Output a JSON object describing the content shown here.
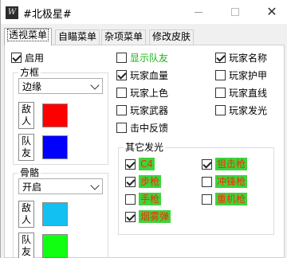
{
  "window": {
    "title": "#北极星#",
    "colors": {
      "titlebar": "#ffffff",
      "body": "#f0f0f0",
      "panel": "#ffffff"
    }
  },
  "tabs": [
    {
      "label": "透视菜单",
      "active": true
    },
    {
      "label": "自瞄菜单",
      "active": false
    },
    {
      "label": "杂项菜单",
      "active": false
    },
    {
      "label": "修改皮肤",
      "active": false
    }
  ],
  "enable": {
    "label": "启用",
    "checked": true
  },
  "box_group": {
    "title": "方框",
    "select_value": "边缘",
    "enemy_label": "敌人",
    "enemy_color": "#ff0000",
    "ally_label": "队友",
    "ally_color": "#0000ff"
  },
  "bone_group": {
    "title": "骨骼",
    "select_value": "开启",
    "enemy_label": "敌人",
    "enemy_color": "#12c1f2",
    "ally_label": "队友",
    "ally_color": "#11ff11"
  },
  "options_col1": [
    {
      "label": "显示队友",
      "checked": false,
      "color": "#19b319"
    },
    {
      "label": "玩家血量",
      "checked": true
    },
    {
      "label": "玩家上色",
      "checked": false
    },
    {
      "label": "玩家武器",
      "checked": false
    },
    {
      "label": "击中反馈",
      "checked": false
    }
  ],
  "options_col2": [
    {
      "label": "玩家名称",
      "checked": true
    },
    {
      "label": "玩家护甲",
      "checked": false
    },
    {
      "label": "玩家直线",
      "checked": false
    },
    {
      "label": "玩家发光",
      "checked": false
    }
  ],
  "glow_group": {
    "title": "其它发光",
    "items_left": [
      {
        "label": "C4",
        "checked": true
      },
      {
        "label": "步枪",
        "checked": true
      },
      {
        "label": "手枪",
        "checked": false
      },
      {
        "label": "烟雾弹",
        "checked": true
      }
    ],
    "items_right": [
      {
        "label": "狙击枪",
        "checked": true
      },
      {
        "label": "冲锋枪",
        "checked": false
      },
      {
        "label": "重机枪",
        "checked": false
      }
    ],
    "highlight_bg": "#3cd53c",
    "highlight_text": "#ff2a00"
  }
}
